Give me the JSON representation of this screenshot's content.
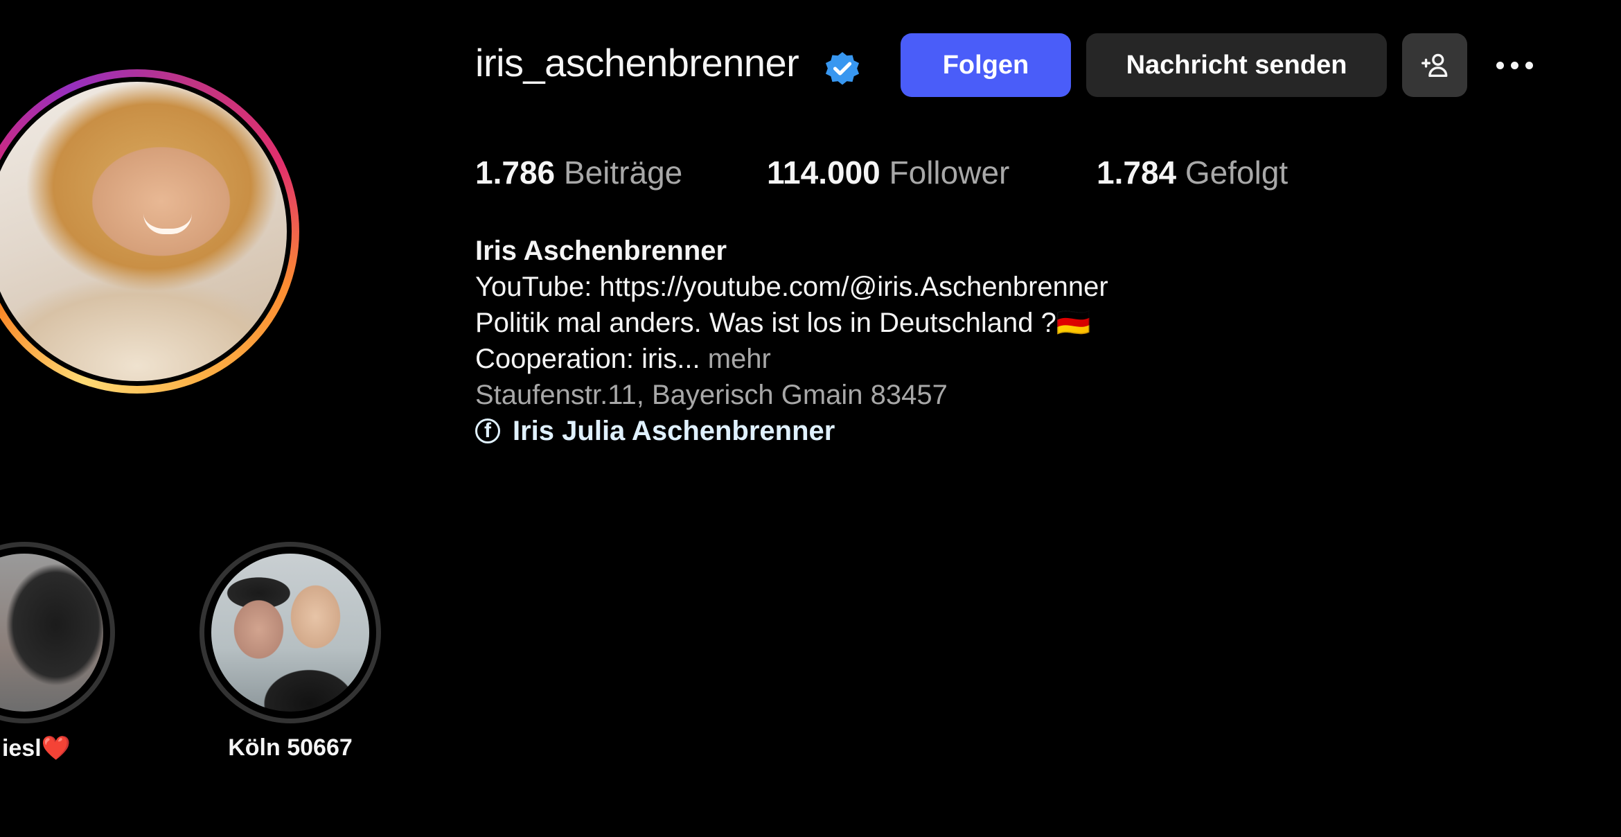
{
  "profile": {
    "username": "iris_aschenbrenner",
    "verified": true,
    "avatar_alt": "Profile picture"
  },
  "actions": {
    "follow_label": "Folgen",
    "message_label": "Nachricht senden",
    "add_user_icon": "add-user-icon",
    "more_icon": "more-options-icon"
  },
  "stats": {
    "posts": {
      "count": "1.786",
      "label": "Beiträge"
    },
    "followers": {
      "count": "114.000",
      "label": "Follower"
    },
    "following": {
      "count": "1.784",
      "label": "Gefolgt"
    }
  },
  "bio": {
    "name": "Iris Aschenbrenner",
    "lines": [
      "YouTube: https://youtube.com/@iris.Aschenbrenner",
      "Politik mal anders. Was ist los in Deutschland ?🇩🇪",
      "Cooperation: iris..."
    ],
    "more_label": "mehr",
    "address": "Staufenstr.11, Bayerisch Gmain 83457",
    "facebook_link": "Iris Julia Aschenbrenner"
  },
  "highlights": [
    {
      "label": "iesl❤️"
    },
    {
      "label": "Köln 50667"
    }
  ],
  "colors": {
    "background": "#000000",
    "follow_button": "#4a5df9",
    "message_button": "#262626",
    "verified_badge": "#3897f0",
    "secondary_text": "#a8a8a8"
  }
}
